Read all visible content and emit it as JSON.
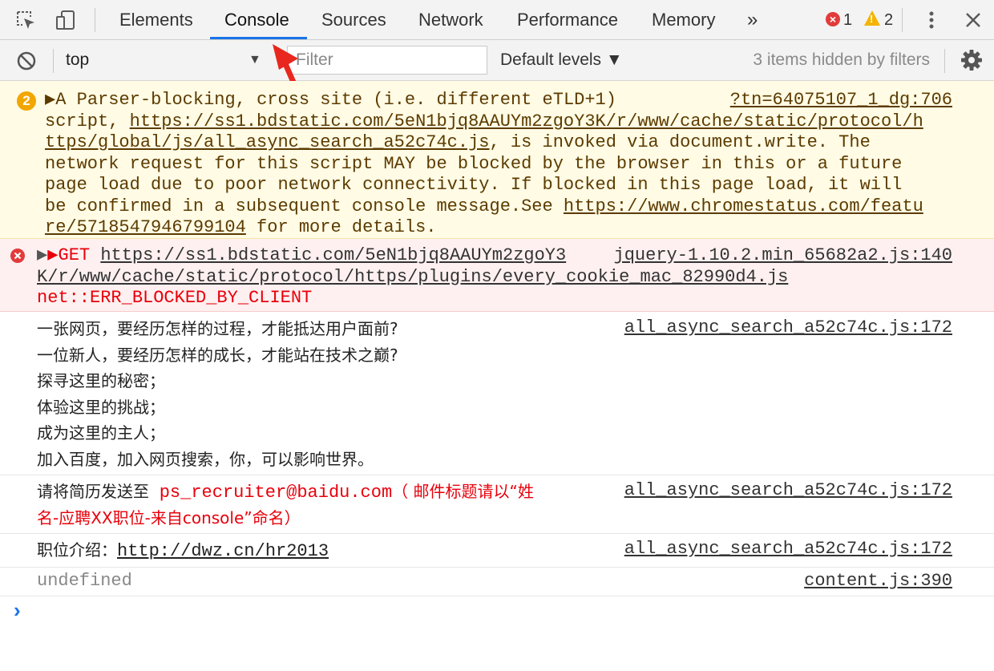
{
  "tabs": [
    "Elements",
    "Console",
    "Sources",
    "Network",
    "Performance",
    "Memory"
  ],
  "more_tabs_label": "»",
  "error_count": "1",
  "warning_count": "2",
  "toolbar": {
    "context": "top",
    "filter_placeholder": "Filter",
    "levels": "Default levels ▼",
    "hidden_note": "3 items hidden by filters"
  },
  "warning": {
    "badge": "2",
    "lines": [
      "▶A Parser-blocking, cross site (i.e. different eTLD+1)",
      "script, ",
      "ttps/global/js/all_async_search_a52c74c.js",
      "network request for this script MAY be blocked by the browser in this or a future",
      "page load due to poor network connectivity. If blocked in this page load, it will",
      "be confirmed in a subsequent console message.See ",
      "re/5718547946799104"
    ],
    "url1": "https://ss1.bdstatic.com/5eN1bjq8AAUYm2zgoY3K/r/www/cache/static/protocol/h",
    "url1_tail": ", is invoked via document.write. The",
    "url2": "https://www.chromestatus.com/featu",
    "tail": " for more details.",
    "source": "?tn=64075107_1_dg:706"
  },
  "error": {
    "prefix": "▶GET ",
    "url_line1": "https://ss1.bdstatic.com/5eN1bjq8AAUYm2zgoY3",
    "url_line2": "K/r/www/cache/static/protocol/https/plugins/every_cookie_mac_82990d4.js",
    "message": "net::ERR_BLOCKED_BY_CLIENT",
    "source": "jquery-1.10.2.min_65682a2.js:140"
  },
  "log1": {
    "lines": [
      "一张网页，要经历怎样的过程，才能抵达用户面前?",
      "一位新人，要经历怎样的成长，才能站在技术之巅?",
      "探寻这里的秘密；",
      "体验这里的挑战；",
      "成为这里的主人；",
      "加入百度，加入网页搜索，你，可以影响世界。"
    ],
    "source": "all_async_search_a52c74c.js:172"
  },
  "log2": {
    "prefix": "请将简历发送至  ",
    "email": "ps_recruiter@baidu.com",
    "note1": "（ 邮件标题请以“姓",
    "note2": "名-应聘XX职位-来自console”命名）",
    "source": "all_async_search_a52c74c.js:172"
  },
  "log3": {
    "label": "职位介绍：",
    "url": "http://dwz.cn/hr2013",
    "source": "all_async_search_a52c74c.js:172"
  },
  "log4": {
    "text": "undefined",
    "source": "content.js:390"
  },
  "prompt_symbol": "›"
}
